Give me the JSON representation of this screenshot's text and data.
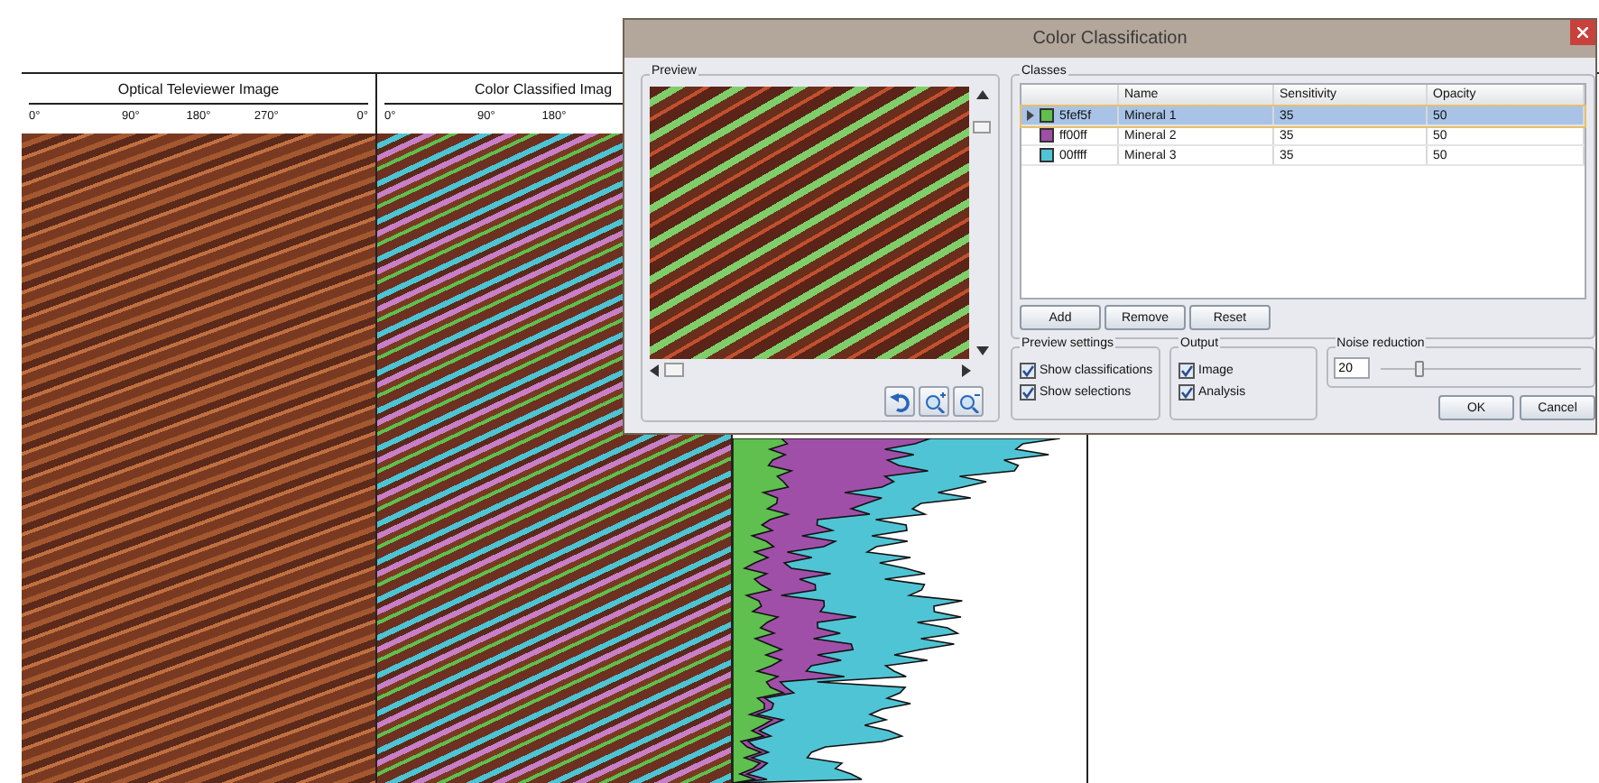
{
  "log_view": {
    "columns": [
      {
        "title": "Optical Televiewer Image",
        "ticks": [
          "0°",
          "90°",
          "180°",
          "270°",
          "0°"
        ],
        "kind": "photo"
      },
      {
        "title": "Color Classified Imag",
        "ticks": [
          "0°",
          "90°",
          "180°"
        ],
        "kind": "classified"
      }
    ]
  },
  "dialog": {
    "title": "Color Classification",
    "preview": {
      "label": "Preview"
    },
    "classes": {
      "label": "Classes",
      "columns": [
        "Name",
        "Sensitivity",
        "Opacity"
      ],
      "rows": [
        {
          "code": "5fef5f",
          "name": "Mineral 1",
          "sensitivity": "35",
          "opacity": "50",
          "color": "#5fbf4f",
          "selected": true
        },
        {
          "code": "ff00ff",
          "name": "Mineral 2",
          "sensitivity": "35",
          "opacity": "50",
          "color": "#a04fa8",
          "selected": false
        },
        {
          "code": "00ffff",
          "name": "Mineral 3",
          "sensitivity": "35",
          "opacity": "50",
          "color": "#4fc4d4",
          "selected": false
        }
      ],
      "buttons": [
        "Add",
        "Remove",
        "Reset"
      ]
    },
    "preview_settings": {
      "label": "Preview settings",
      "options": [
        {
          "label": "Show classifications",
          "checked": true
        },
        {
          "label": "Show selections",
          "checked": true
        }
      ]
    },
    "output": {
      "label": "Output",
      "options": [
        {
          "label": "Image",
          "checked": true
        },
        {
          "label": "Analysis",
          "checked": true
        }
      ]
    },
    "noise_reduction": {
      "label": "Noise reduction",
      "value": "20",
      "level": 0.17
    },
    "buttons": [
      "OK",
      "Cancel"
    ]
  }
}
